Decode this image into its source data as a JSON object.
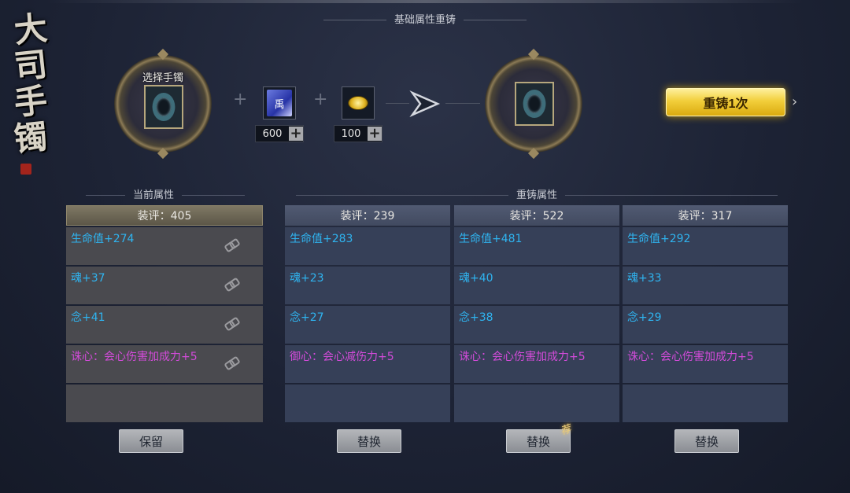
{
  "panel": {
    "title": "基础属性重铸"
  },
  "logo": {
    "text": [
      "大",
      "司",
      "手",
      "镯"
    ]
  },
  "input_slot": {
    "label": "选择手镯"
  },
  "materials": [
    {
      "icon": "talisman-scroll-icon",
      "glyph": "禹",
      "count": "600",
      "add": "+"
    },
    {
      "icon": "gold-coin-icon",
      "count": "100",
      "add": "+"
    }
  ],
  "separator": "+",
  "reforge_button": {
    "label": "重铸1次"
  },
  "more_arrow": "›",
  "current": {
    "title": "当前属性",
    "score": "装评：405",
    "attrs": [
      {
        "text": "生命值+274",
        "color": "blue"
      },
      {
        "text": "魂+37",
        "color": "blue"
      },
      {
        "text": "念+41",
        "color": "blue"
      },
      {
        "text": "诛心：会心伤害加成力+5",
        "color": "pink"
      },
      {
        "text": "",
        "color": "blue"
      }
    ],
    "button": "保留"
  },
  "reforged": {
    "title": "重铸属性",
    "columns": [
      {
        "score": "装评：239",
        "attrs": [
          {
            "text": "生命值+283",
            "color": "blue"
          },
          {
            "text": "魂+23",
            "color": "blue"
          },
          {
            "text": "念+27",
            "color": "blue"
          },
          {
            "text": "御心：会心减伤力+5",
            "color": "pink"
          },
          {
            "text": "",
            "color": "blue"
          }
        ],
        "button": "替换"
      },
      {
        "score": "装评：522",
        "attrs": [
          {
            "text": "生命值+481",
            "color": "blue"
          },
          {
            "text": "魂+40",
            "color": "blue"
          },
          {
            "text": "念+38",
            "color": "blue"
          },
          {
            "text": "诛心：会心伤害加成力+5",
            "color": "pink"
          },
          {
            "text": "",
            "color": "blue"
          }
        ],
        "button": "替换",
        "badge": "荐"
      },
      {
        "score": "装评：317",
        "attrs": [
          {
            "text": "生命值+292",
            "color": "blue"
          },
          {
            "text": "魂+33",
            "color": "blue"
          },
          {
            "text": "念+29",
            "color": "blue"
          },
          {
            "text": "诛心：会心伤害加成力+5",
            "color": "pink"
          },
          {
            "text": "",
            "color": "blue"
          }
        ],
        "button": "替换"
      }
    ]
  }
}
